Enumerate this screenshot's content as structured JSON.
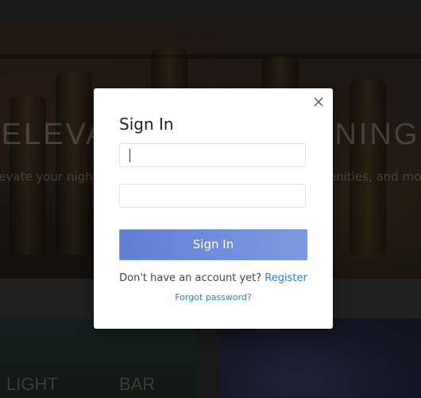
{
  "background": {
    "hero_title": "ELEVATE YOUR EVENING",
    "hero_subtitle": "Elevate your nightlife with exclusive access to music, amenities, and more",
    "card_left_label": "LIGHT",
    "card_right_label": "BAR"
  },
  "modal": {
    "title": "Sign In",
    "username_value": "",
    "password_value": "",
    "submit_label": "Sign In",
    "register_prompt": "Don't have an account yet?",
    "register_link": "Register",
    "forgot_link": "Forgot password?",
    "close_icon": "close-icon"
  },
  "colors": {
    "button_start": "#5f7fd5",
    "button_end": "#7d9ae0",
    "link": "#2a7de1"
  }
}
